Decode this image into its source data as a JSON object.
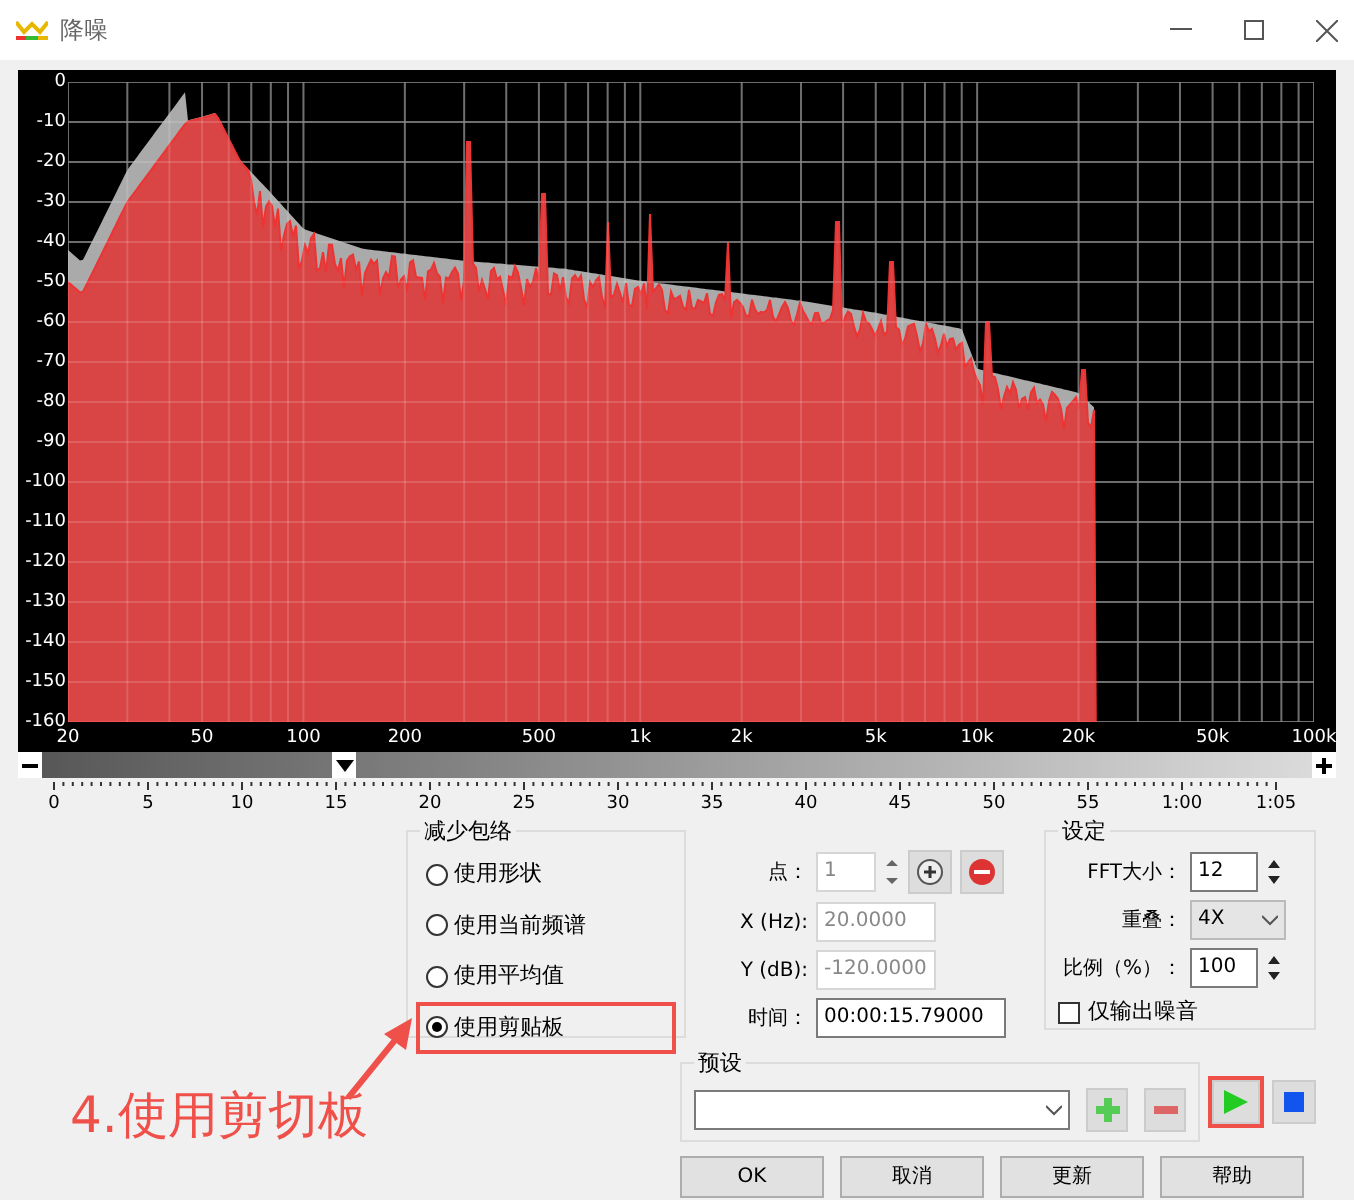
{
  "window": {
    "title": "降噪"
  },
  "spectrum": {
    "y_labels": [
      "0",
      "-10",
      "-20",
      "-30",
      "-40",
      "-50",
      "-60",
      "-70",
      "-80",
      "-90",
      "-100",
      "-110",
      "-120",
      "-130",
      "-140",
      "-150",
      "-160"
    ],
    "x_labels": [
      "20",
      "50",
      "100",
      "200",
      "500",
      "1k",
      "2k",
      "5k",
      "10k",
      "20k",
      "50k",
      "100k"
    ]
  },
  "timeline": {
    "labels": [
      "0",
      "5",
      "10",
      "15",
      "20",
      "25",
      "30",
      "35",
      "40",
      "45",
      "50",
      "55",
      "1:00",
      "1:05"
    ]
  },
  "envelope": {
    "title": "减少包络",
    "options": [
      {
        "label": "使用形状",
        "selected": false,
        "highlighted": false
      },
      {
        "label": "使用当前频谱",
        "selected": false,
        "highlighted": false
      },
      {
        "label": "使用平均值",
        "selected": false,
        "highlighted": false
      },
      {
        "label": "使用剪贴板",
        "selected": true,
        "highlighted": true
      }
    ]
  },
  "point": {
    "label": "点：",
    "value": "1",
    "disabled": true
  },
  "fields": [
    {
      "label": "X (Hz):",
      "value": "20.0000",
      "disabled": true
    },
    {
      "label": "Y (dB):",
      "value": "-120.0000",
      "disabled": true
    },
    {
      "label": "时间：",
      "value": "00:00:15.79000",
      "disabled": false
    }
  ],
  "settings": {
    "title": "设定",
    "fft": {
      "label": "FFT大小：",
      "value": "12"
    },
    "overlap": {
      "label": "重叠：",
      "value": "4X"
    },
    "ratio": {
      "label": "比例（%）：",
      "value": "100"
    },
    "noise_only": {
      "label": "仅输出噪音",
      "checked": false
    }
  },
  "preset": {
    "title": "预设"
  },
  "play": {
    "highlighted": true
  },
  "buttons": [
    "OK",
    "取消",
    "更新",
    "帮助"
  ],
  "annotation": {
    "text": "4.使用剪切板"
  }
}
